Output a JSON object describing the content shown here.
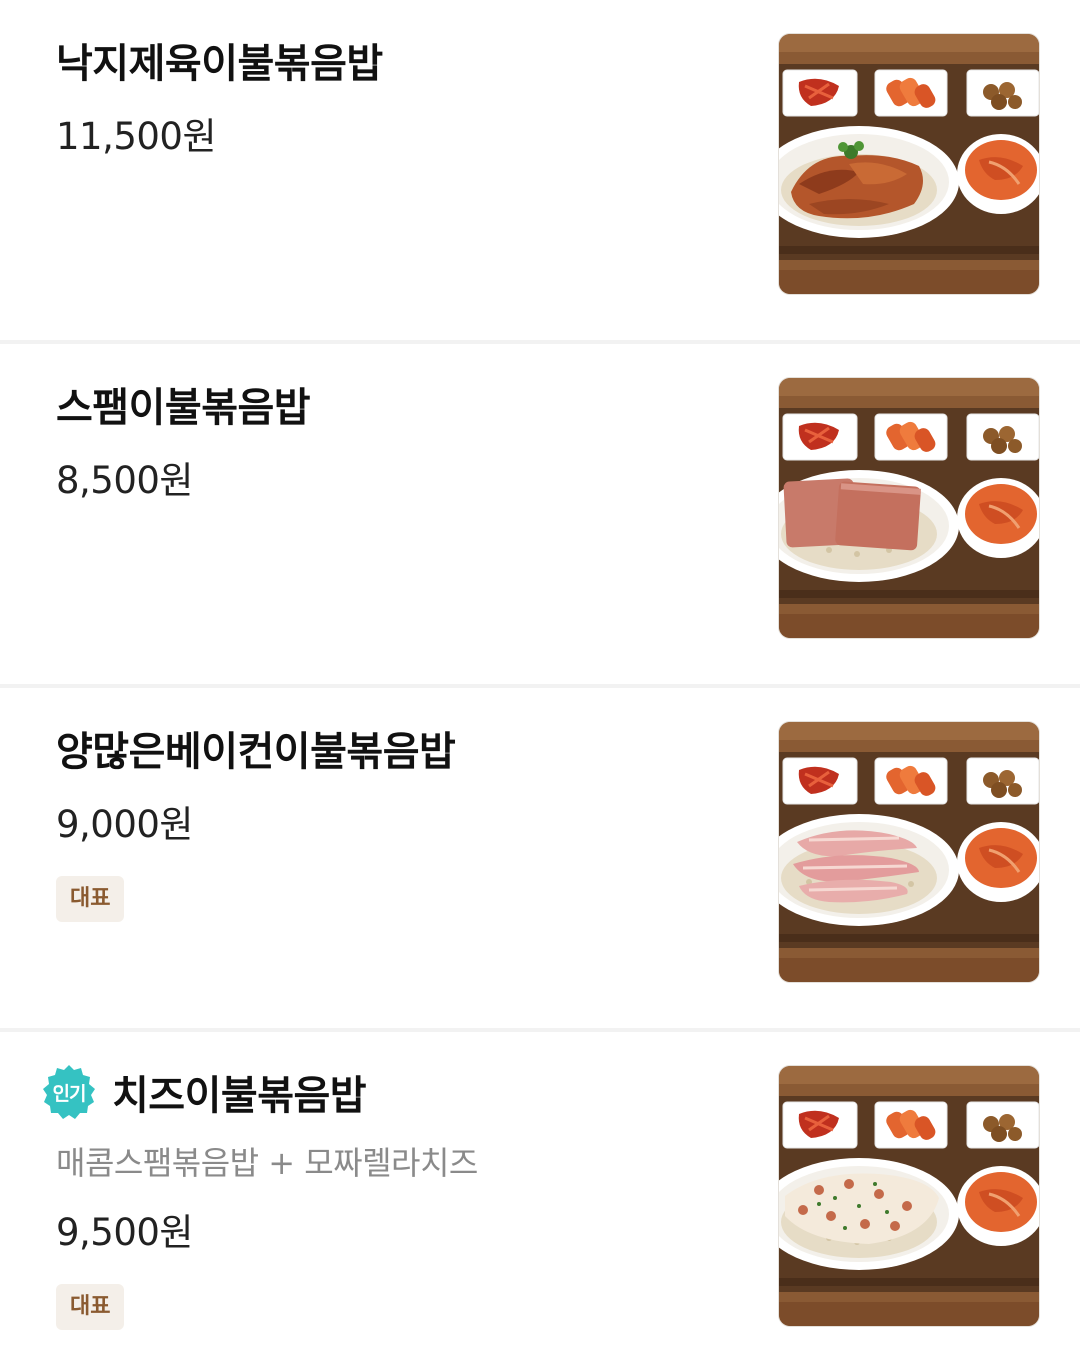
{
  "menu": {
    "items": [
      {
        "name": "낙지제육이불볶음밥",
        "price": "11,500원",
        "topping": "pork",
        "image_icon": "food-photo-icon"
      },
      {
        "name": "스팸이불볶음밥",
        "price": "8,500원",
        "topping": "spam",
        "image_icon": "food-photo-icon"
      },
      {
        "name": "양많은베이컨이불볶음밥",
        "price": "9,000원",
        "badge": "대표",
        "topping": "bacon",
        "image_icon": "food-photo-icon"
      },
      {
        "name": "치즈이불볶음밥",
        "hot_label": "인기",
        "description": "매콤스팸볶음밥 + 모짜렐라치즈",
        "price": "9,500원",
        "badge": "대표",
        "topping": "cheese",
        "image_icon": "food-photo-icon"
      }
    ]
  },
  "colors": {
    "hot_badge": "#35c2c2",
    "badge_bg": "#f4efe9",
    "badge_text": "#8a5a30",
    "divider": "#f2f2f2",
    "tray": "#5a3a22",
    "wood": "#8a5a34"
  }
}
